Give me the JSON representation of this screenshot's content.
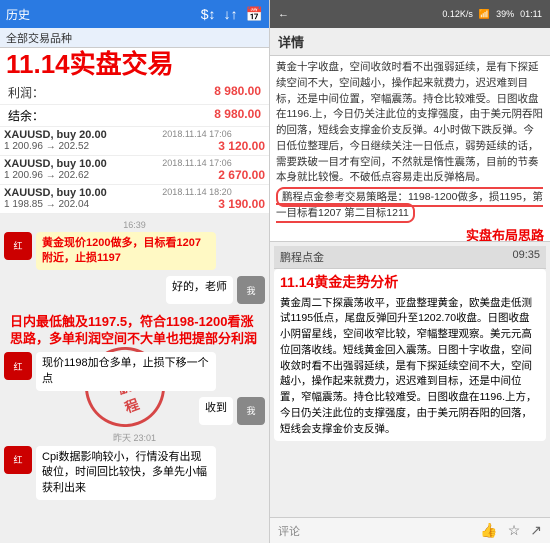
{
  "left": {
    "header": {
      "title": "历史",
      "subtitle": "全部交易品种",
      "icons": [
        "$↕",
        "↓↑",
        "📅"
      ]
    },
    "big_title": "11.14实盘交易",
    "profit": {
      "label": "利润：",
      "value": "8 980.00"
    },
    "balance": {
      "label": "结余：",
      "value": "8 980.00"
    },
    "trades": [
      {
        "pair": "XAUUSD, buy 20.00",
        "price": "1 200.96 → 202.52",
        "date": "2018.11.14 17:06",
        "profit": "3 120.00"
      },
      {
        "pair": "XAUUSD, buy 10.00",
        "price": "1 200.96 → 202.62",
        "date": "2018.11.14 17:06",
        "profit": "2 670.00"
      },
      {
        "pair": "XAUUSD, buy 10.00",
        "price": "1 198.85 → 202.04",
        "date": "2018.11.14 18:20",
        "profit": "3 190.00"
      }
    ],
    "stamp_text": "点\n鹏\n程",
    "chat": [
      {
        "type": "system_time",
        "text": "16:39"
      },
      {
        "type": "left",
        "avatar": "红",
        "bubble_highlight": "黄金现价1200做多，目标看1207附近，止损1197",
        "is_highlight": true
      },
      {
        "type": "right",
        "avatar": "我",
        "text": "好的，老师"
      },
      {
        "type": "left_big",
        "text": "日内最低触及1197.5，符合1198-1200看涨思路，多单利润空间不大单也把提部分利润"
      },
      {
        "type": "left",
        "avatar": "红",
        "text": "现价1198加仓多单，止损下移一个点"
      },
      {
        "type": "right",
        "avatar": "我",
        "text": "收到"
      },
      {
        "type": "system_time",
        "text": "昨天 23:01"
      },
      {
        "type": "left",
        "avatar": "红",
        "text": "Cpi数据影响较小，行情没有出现破位，时间回比较快，多单先小幅获利出来"
      }
    ]
  },
  "right": {
    "header": {
      "signal": "0.12K/s",
      "wifi": "SD",
      "battery": "39%",
      "time": "01:11"
    },
    "detail_title": "详情",
    "detail_text": "黄金十字收盘，空间收敛时看不出强弱延续，是有下探延续空间不大，空间越小，操作起来就费力，迟迟难到目标，还是中间位置，窄幅震荡。持仓比较难受。日图收盘在1196.上，今日仍关注此位的支撑强度，由于美元阴吞阳的回落，短线会支撑金价支反弹。4小时做下跌反弹。今日低位整理后，今日继续关注一日低点，弱势延续的话，需要跌破一目才有空间，不然就是惰性震荡，目前的节奏本身就比较慢。不破低点容易走出反弹格局。",
    "circle_text": "鹏程点金参考交易策略是：1198-1200做多，损1195，第一目标看1207 第二目标1211",
    "detail_label": "实盘布局思路",
    "chat_items": [
      {
        "name": "鹏程点金",
        "time": "09:35",
        "title": "11.14黄金走势分析",
        "text": "黄金周二下探震荡收平，亚盘整理黄金，欧美盘走低测试1195低点，尾盘反弹回升至1202.70收盘。日图收盘小阴留星线，空间收窄比较，窄幅整理观察。美元元高位回落收线。短线黄金回入震荡。日图十字收盘，空间收敛时看不出强弱延续，是有下探延续空间不大，空间越小，操作起来就费力，迟迟难到目标，还是中间位置，窄幅震荡。持仓比较难受。日图收盘在1196.上方，今日仍关注此位的支撑强度，由于美元阴吞阳的回落，短线会支撑金价支反弹。"
      }
    ],
    "comment_placeholder": "评论"
  }
}
